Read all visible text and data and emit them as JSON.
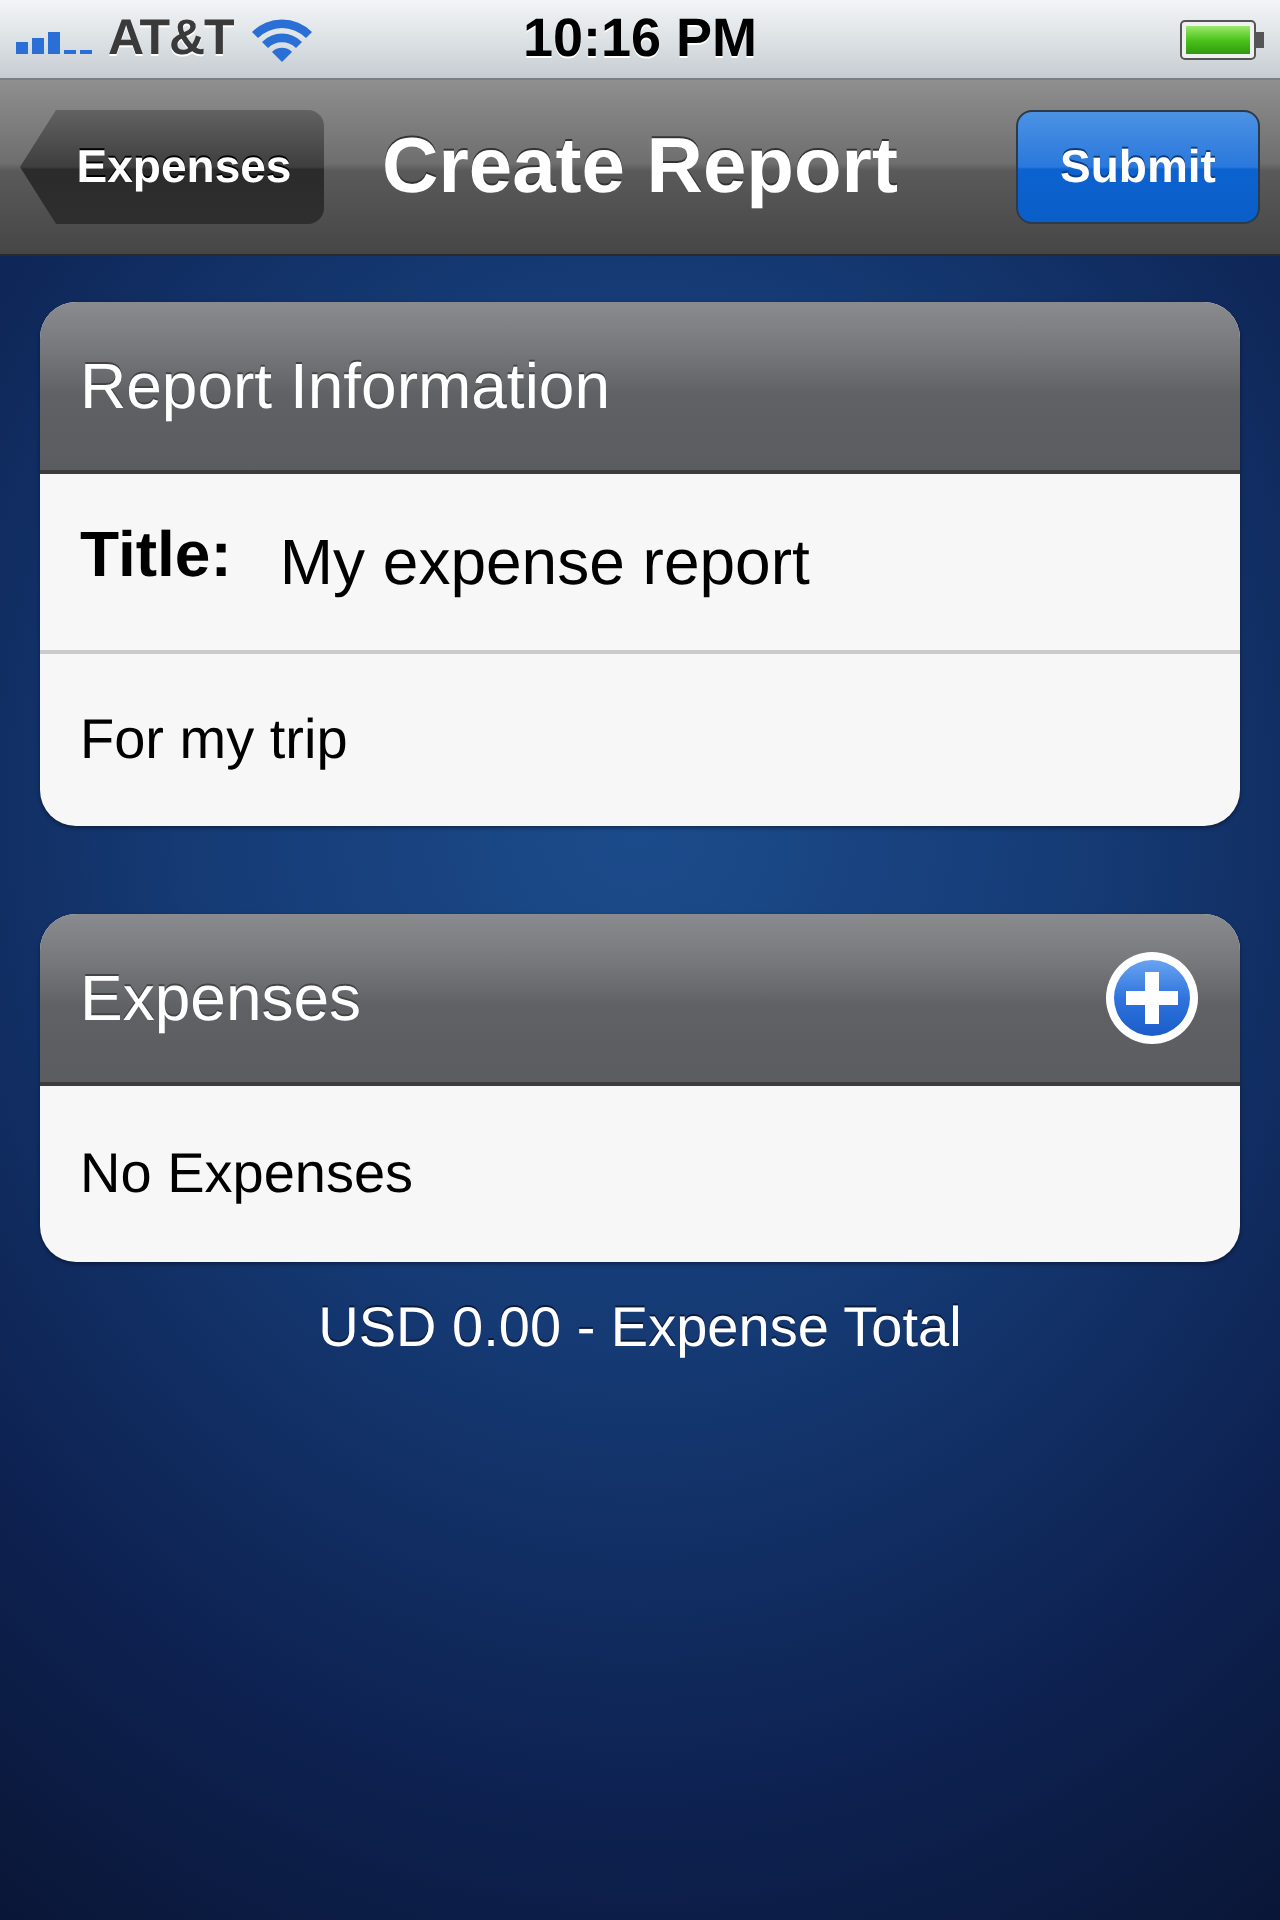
{
  "status_bar": {
    "carrier": "AT&T",
    "time": "10:16 PM"
  },
  "nav_bar": {
    "back_button": "Expenses",
    "title": "Create Report",
    "action_button": "Submit"
  },
  "sections": [
    {
      "header": "Report Information",
      "add_button": false,
      "rows": [
        {
          "kind": "field",
          "label": "Title:",
          "value": "My expense report"
        },
        {
          "kind": "text",
          "text": "For my trip"
        }
      ]
    },
    {
      "header": "Expenses",
      "add_button": true,
      "rows": [
        {
          "kind": "text",
          "text": "No Expenses"
        }
      ]
    }
  ],
  "footer": "USD 0.00 - Expense Total"
}
